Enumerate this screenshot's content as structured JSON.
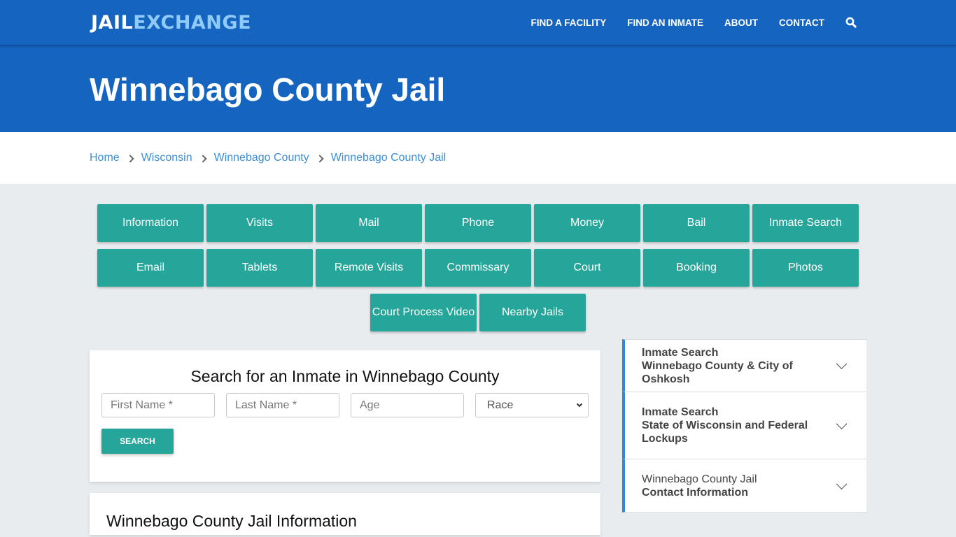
{
  "header": {
    "logo": {
      "part1": "JAIL",
      "part2": "EXCHANGE"
    },
    "nav": [
      {
        "label": "FIND A FACILITY"
      },
      {
        "label": "FIND AN INMATE"
      },
      {
        "label": "ABOUT"
      },
      {
        "label": "CONTACT"
      }
    ],
    "search_icon": "search-icon"
  },
  "page": {
    "title": "Winnebago County Jail"
  },
  "breadcrumb": [
    {
      "label": "Home"
    },
    {
      "label": "Wisconsin"
    },
    {
      "label": "Winnebago County"
    },
    {
      "label": "Winnebago County Jail"
    }
  ],
  "tiles": [
    {
      "label": "Information"
    },
    {
      "label": "Visits"
    },
    {
      "label": "Mail"
    },
    {
      "label": "Phone"
    },
    {
      "label": "Money"
    },
    {
      "label": "Bail"
    },
    {
      "label": "Inmate Search"
    },
    {
      "label": "Email"
    },
    {
      "label": "Tablets"
    },
    {
      "label": "Remote Visits"
    },
    {
      "label": "Commissary"
    },
    {
      "label": "Court"
    },
    {
      "label": "Booking"
    },
    {
      "label": "Photos"
    },
    {
      "label": "Court Process Video"
    },
    {
      "label": "Nearby Jails"
    }
  ],
  "search_form": {
    "title": "Search for an Inmate in Winnebago County",
    "first_name_placeholder": "First Name *",
    "last_name_placeholder": "Last Name *",
    "age_placeholder": "Age",
    "race_selected": "Race",
    "submit_label": "SEARCH"
  },
  "info_section": {
    "title": "Winnebago County Jail Information"
  },
  "sidebar": {
    "accordions": [
      {
        "line1": "Inmate Search",
        "line2": "Winnebago County & City of Oshkosh"
      },
      {
        "line1": "Inmate Search",
        "line2": "State of Wisconsin and Federal Lockups"
      },
      {
        "line1": "Winnebago County Jail",
        "line2": "Contact Information"
      }
    ]
  },
  "colors": {
    "primary_blue": "#1565c0",
    "logo_accent": "#90caf9",
    "teal": "#26a69a",
    "link_blue": "#3b8fd9",
    "accordion_accent": "#2e86de",
    "page_bg": "#e9ecef"
  }
}
